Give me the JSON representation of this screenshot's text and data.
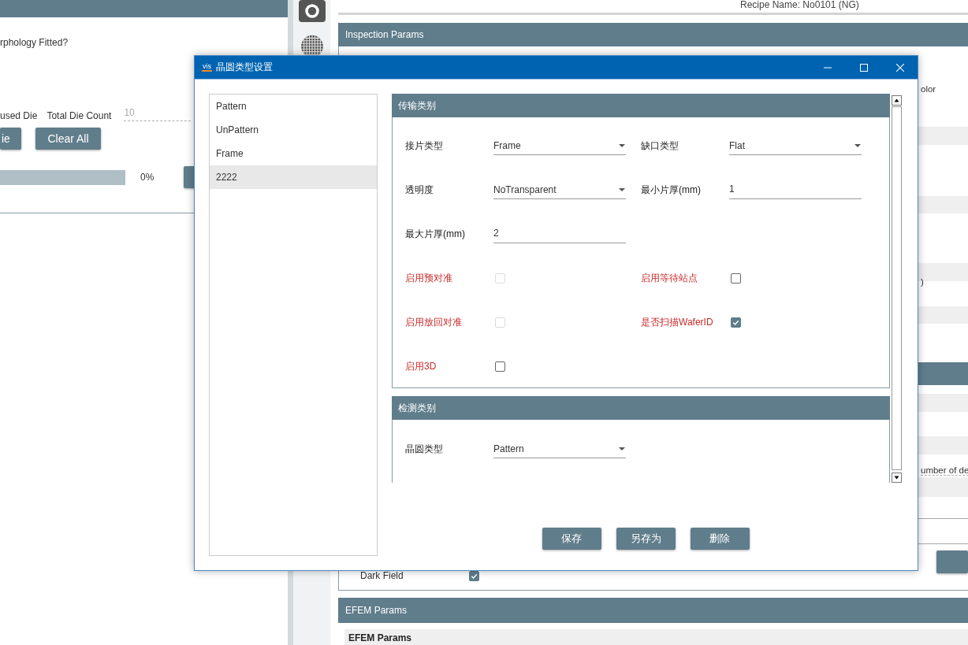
{
  "left_panel": {
    "question": "rphology Fitted?",
    "used_die_label": "used Die",
    "total_label": "Total Die Count",
    "total_value": "10",
    "buttons": [
      "ie",
      "Clear All"
    ],
    "progress": {
      "level": 0,
      "reading": "0%"
    }
  },
  "right_panel": {
    "recipe_name": "Recipe Name: No0101 (NG)",
    "inspection_header": "Inspection Params",
    "edge_texts": [
      "olor",
      ")",
      "umber of de"
    ],
    "dark_field": {
      "label": "Dark Field",
      "checked": true
    },
    "efem_header": "EFEM Params",
    "efem_subheader": "EFEM Params"
  },
  "dialog": {
    "logo": "vis",
    "title": "晶圆类型设置",
    "list": [
      {
        "label": "Pattern",
        "selected": false
      },
      {
        "label": "UnPattern",
        "selected": false
      },
      {
        "label": "Frame",
        "selected": false
      },
      {
        "label": "2222",
        "selected": true
      }
    ],
    "sections": [
      {
        "title": "传输类别",
        "rows": [
          [
            {
              "kind": "select",
              "label": "接片类型",
              "value": "Frame"
            },
            {
              "kind": "select",
              "label": "缺口类型",
              "value": "Flat"
            }
          ],
          [
            {
              "kind": "select",
              "label": "透明度",
              "value": "NoTransparent"
            },
            {
              "kind": "input",
              "label": "最小片厚(mm)",
              "value": "1"
            }
          ],
          [
            {
              "kind": "input",
              "label": "最大片厚(mm)",
              "value": "2"
            }
          ],
          [
            {
              "kind": "checkbox",
              "label": "启用预对准",
              "checked": false,
              "disabled": true
            },
            {
              "kind": "checkbox",
              "label": "启用等待站点",
              "checked": false,
              "disabled": false
            }
          ],
          [
            {
              "kind": "checkbox",
              "label": "启用放回对准",
              "checked": false,
              "disabled": true
            },
            {
              "kind": "checkbox",
              "label": "是否扫描WaferID",
              "checked": true,
              "disabled": false
            }
          ],
          [
            {
              "kind": "checkbox",
              "label": "启用3D",
              "checked": false,
              "disabled": false
            }
          ]
        ]
      },
      {
        "title": "检测类别",
        "rows": [
          [
            {
              "kind": "select",
              "label": "晶圆类型",
              "value": "Pattern"
            }
          ]
        ]
      }
    ],
    "buttons": [
      "保存",
      "另存为",
      "删除"
    ]
  }
}
